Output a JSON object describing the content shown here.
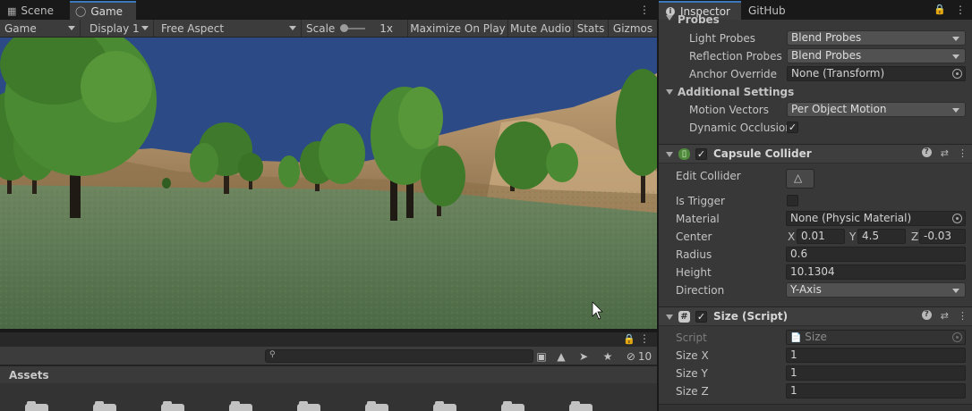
{
  "game_panel": {
    "tabs": [
      {
        "label": "Scene",
        "icon": "grid-icon"
      },
      {
        "label": "Game",
        "icon": "gamepad-icon"
      }
    ],
    "toolbar": {
      "mode": "Game",
      "display": "Display 1",
      "aspect": "Free Aspect",
      "scale_label": "Scale",
      "scale_value": "1x",
      "maximize": "Maximize On Play",
      "mute": "Mute Audio",
      "stats": "Stats",
      "gizmos": "Gizmos"
    }
  },
  "project_panel": {
    "search": {
      "placeholder": ""
    },
    "hidden_count": "10",
    "assets_label": "Assets"
  },
  "inspector": {
    "tabs": [
      {
        "label": "Inspector",
        "icon": "info-icon"
      },
      {
        "label": "GitHub"
      }
    ],
    "probes_header": "Probes",
    "light_probes": {
      "label": "Light Probes",
      "value": "Blend Probes"
    },
    "reflection_probes": {
      "label": "Reflection Probes",
      "value": "Blend Probes"
    },
    "anchor_override": {
      "label": "Anchor Override",
      "value": "None (Transform)"
    },
    "additional_settings": "Additional Settings",
    "motion_vectors": {
      "label": "Motion Vectors",
      "value": "Per Object Motion"
    },
    "dynamic_occlusion": {
      "label": "Dynamic Occlusion",
      "checked": true
    },
    "capsule_collider": {
      "title": "Capsule Collider",
      "enabled": true,
      "edit_collider": "Edit Collider",
      "is_trigger": {
        "label": "Is Trigger",
        "checked": false
      },
      "material": {
        "label": "Material",
        "value": "None (Physic Material)"
      },
      "center": {
        "label": "Center",
        "x_label": "X",
        "x": "0.01",
        "y_label": "Y",
        "y": "4.5",
        "z_label": "Z",
        "z": "-0.03"
      },
      "radius": {
        "label": "Radius",
        "value": "0.6"
      },
      "height": {
        "label": "Height",
        "value": "10.1304"
      },
      "direction": {
        "label": "Direction",
        "value": "Y-Axis"
      }
    },
    "size_script": {
      "title": "Size (Script)",
      "enabled": true,
      "script": {
        "label": "Script",
        "value": "Size"
      },
      "size_x": {
        "label": "Size X",
        "value": "1"
      },
      "size_y": {
        "label": "Size Y",
        "value": "1"
      },
      "size_z": {
        "label": "Size Z",
        "value": "1"
      }
    }
  },
  "colors": {
    "sky": "#2b4a86",
    "grass": "#5a7a52",
    "accent_tab": "#3a79bb",
    "panel_bg": "#383838"
  }
}
